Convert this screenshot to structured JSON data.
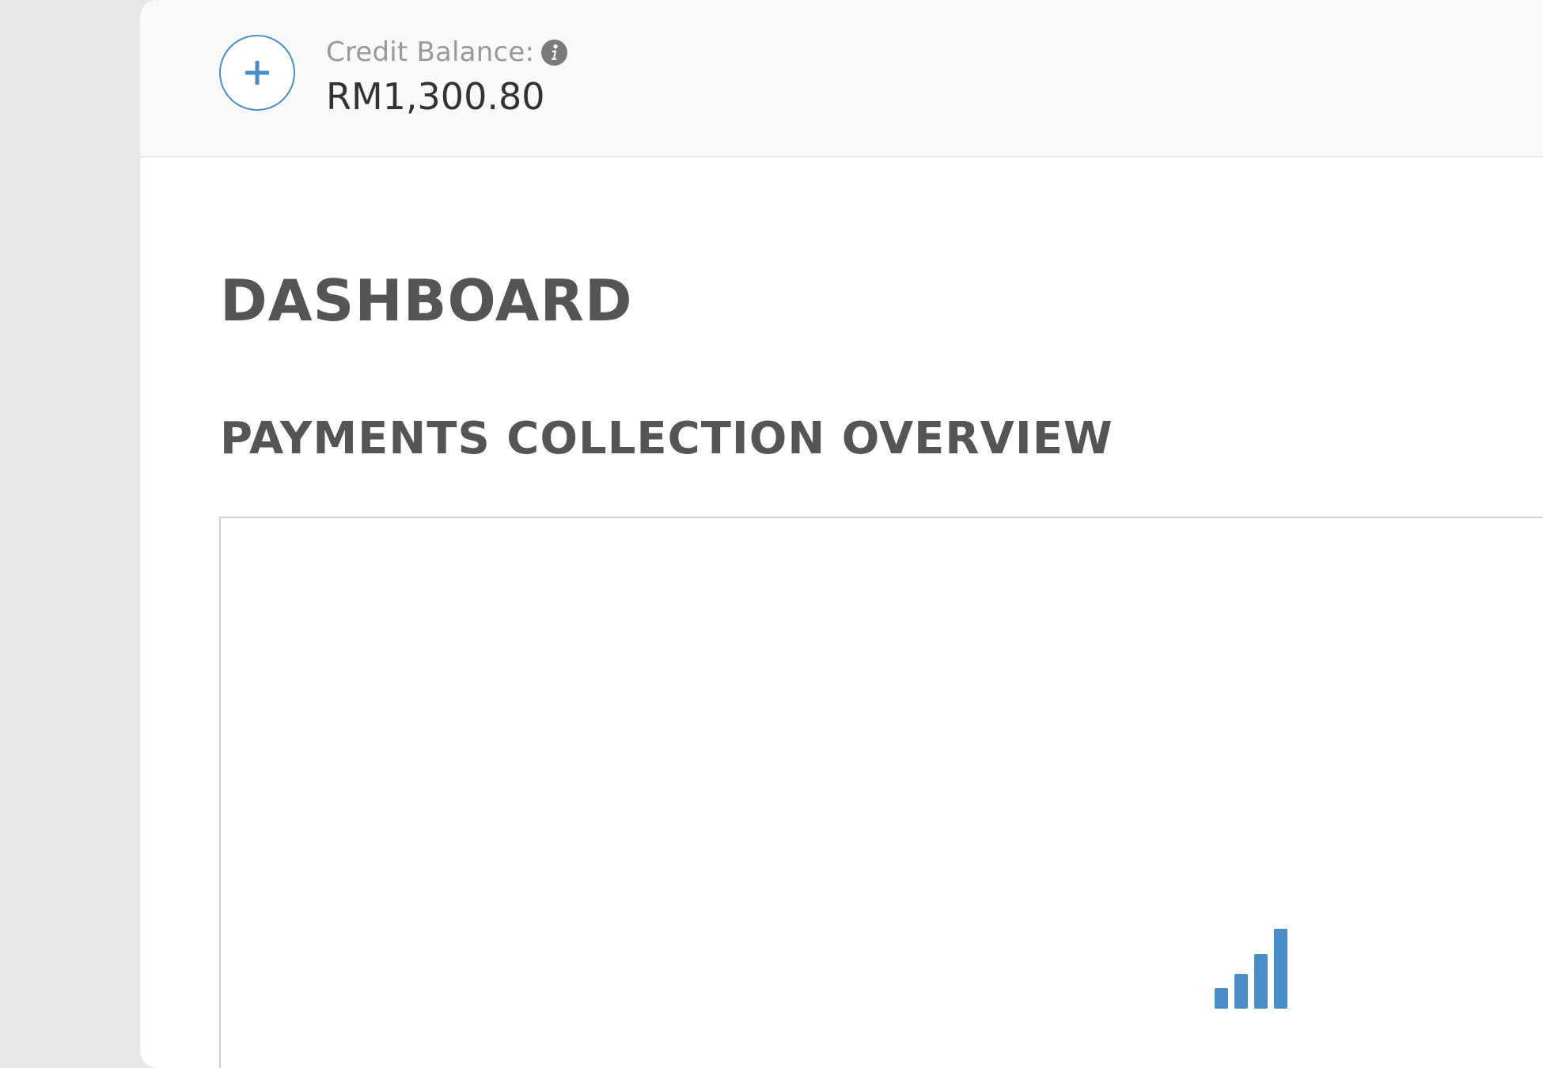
{
  "topbar": {
    "add_credit_icon": "plus-icon",
    "credit_label": "Credit Balance:",
    "info_icon": "info-icon",
    "credit_amount": "RM1,300.80"
  },
  "main": {
    "page_title": "DASHBOARD",
    "section_title": "PAYMENTS COLLECTION OVERVIEW",
    "chart_placeholder_icon": "bar-chart-icon"
  },
  "colors": {
    "accent": "#4a8ec9",
    "heading": "#555555",
    "label": "#999999",
    "amount": "#333333",
    "topbar_bg": "#f9f9f9",
    "page_bg": "#e7e7e7"
  }
}
